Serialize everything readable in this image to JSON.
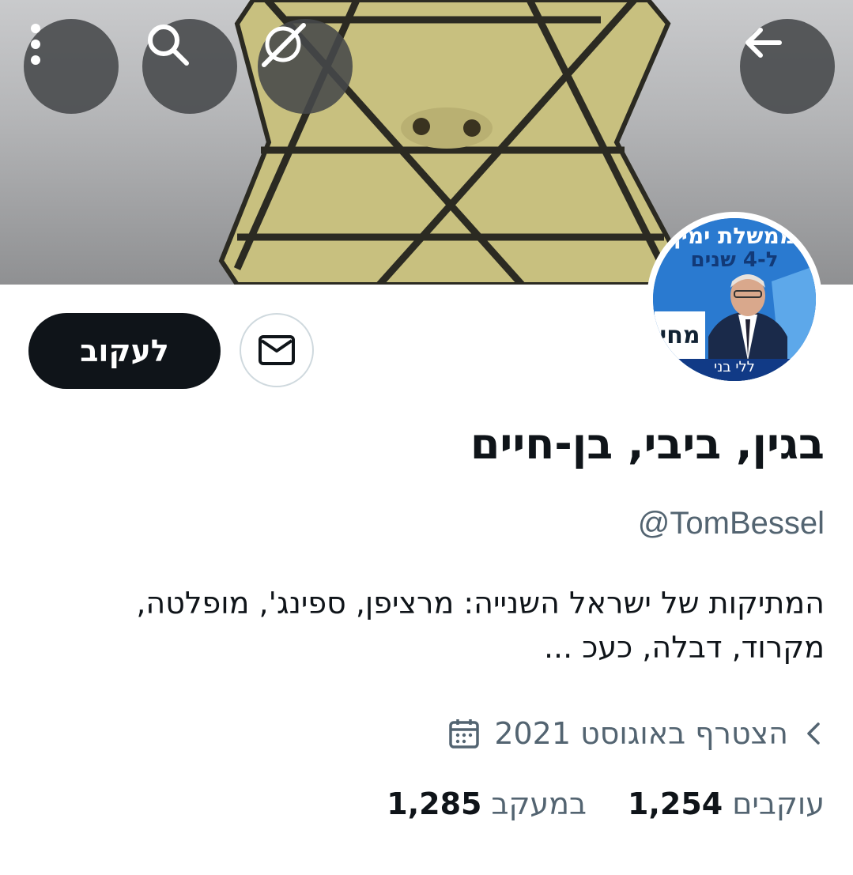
{
  "header": {
    "back_icon": "arrow-left-icon",
    "grok_icon": "grok-icon",
    "search_icon": "search-icon",
    "more_icon": "more-vertical-icon"
  },
  "avatar": {
    "line1": "ממשלת ימין",
    "line2": "ל-4 שנים",
    "sign": "מחי",
    "footer": "ללי בני"
  },
  "actions": {
    "follow_label": "לעקוב",
    "message_icon": "mail-icon"
  },
  "profile": {
    "display_name": "בגין, ביבי, בן-חיים",
    "handle": "@TomBessel",
    "bio_line1": "המתיקות של ישראל השנייה: מרציפן, ספינג', מופלטה,",
    "bio_line2": "מקרוד,  דבלה, כעכ ...",
    "joined": "הצטרף באוגוסט 2021"
  },
  "stats": {
    "following_count": "1,285",
    "following_label": "במעקב",
    "followers_count": "1,254",
    "followers_label": "עוקבים"
  },
  "colors": {
    "text": "#0f1419",
    "secondary": "#536471",
    "follow_bg": "#0f1419",
    "banner_star": "#c9c183"
  }
}
